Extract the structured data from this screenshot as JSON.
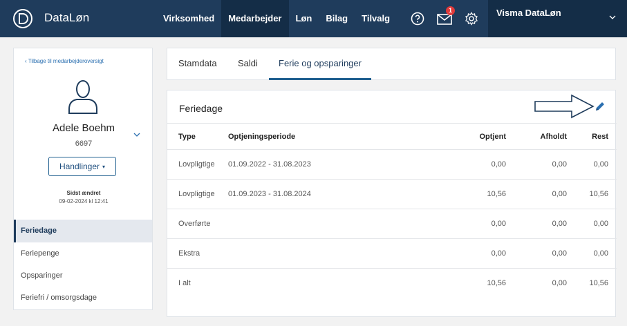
{
  "header": {
    "brand": "DataLøn",
    "nav": [
      "Virksomhed",
      "Medarbejder",
      "Løn",
      "Bilag",
      "Tilvalg"
    ],
    "active_nav": "Medarbejder",
    "notification_count": "1",
    "account": "Visma DataLøn",
    "colors": {
      "bar": "#1f3c5c",
      "active": "#142d47",
      "badge": "#e03a3a"
    }
  },
  "employee": {
    "back_link": "Tilbage til medarbejderoversigt",
    "name": "Adele Boehm",
    "number": "6697",
    "actions_label": "Handlinger",
    "last_changed_label": "Sidst ændret",
    "last_changed_value": "09-02-2024 kl 12:41"
  },
  "side_menu": {
    "items": [
      "Feriedage",
      "Feriepenge",
      "Opsparinger",
      "Feriefri / omsorgsdage"
    ],
    "active": "Feriedage"
  },
  "tabs": {
    "items": [
      "Stamdata",
      "Saldi",
      "Ferie og opsparinger"
    ],
    "active": "Ferie og opsparinger"
  },
  "section": {
    "title": "Feriedage",
    "edit_icon": "pencil-icon"
  },
  "table": {
    "headers": [
      "Type",
      "Optjeningsperiode",
      "Optjent",
      "Afholdt",
      "Rest"
    ],
    "rows": [
      [
        "Lovpligtige",
        "01.09.2022 - 31.08.2023",
        "0,00",
        "0,00",
        "0,00"
      ],
      [
        "Lovpligtige",
        "01.09.2023 - 31.08.2024",
        "10,56",
        "0,00",
        "10,56"
      ],
      [
        "Overførte",
        "",
        "0,00",
        "0,00",
        "0,00"
      ],
      [
        "Ekstra",
        "",
        "0,00",
        "0,00",
        "0,00"
      ],
      [
        "I alt",
        "",
        "10,56",
        "0,00",
        "10,56"
      ]
    ]
  }
}
